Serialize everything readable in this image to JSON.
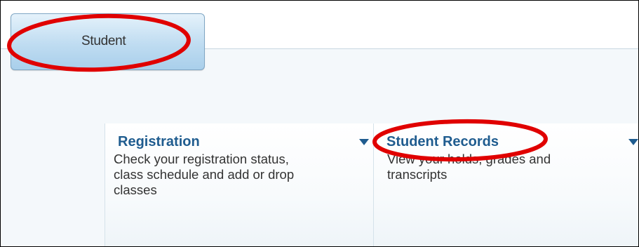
{
  "tab": {
    "label": "Student"
  },
  "cards": [
    {
      "title": "Registration",
      "description_lines": [
        "Check your registration status,",
        "class schedule and add or drop",
        "classes"
      ]
    },
    {
      "title": "Student Records",
      "description_lines": [
        "View your holds, grades and",
        "transcripts"
      ]
    }
  ],
  "colors": {
    "annotation": "#e00000",
    "title": "#1f5c8f",
    "tab_border": "#7fa6c4"
  }
}
